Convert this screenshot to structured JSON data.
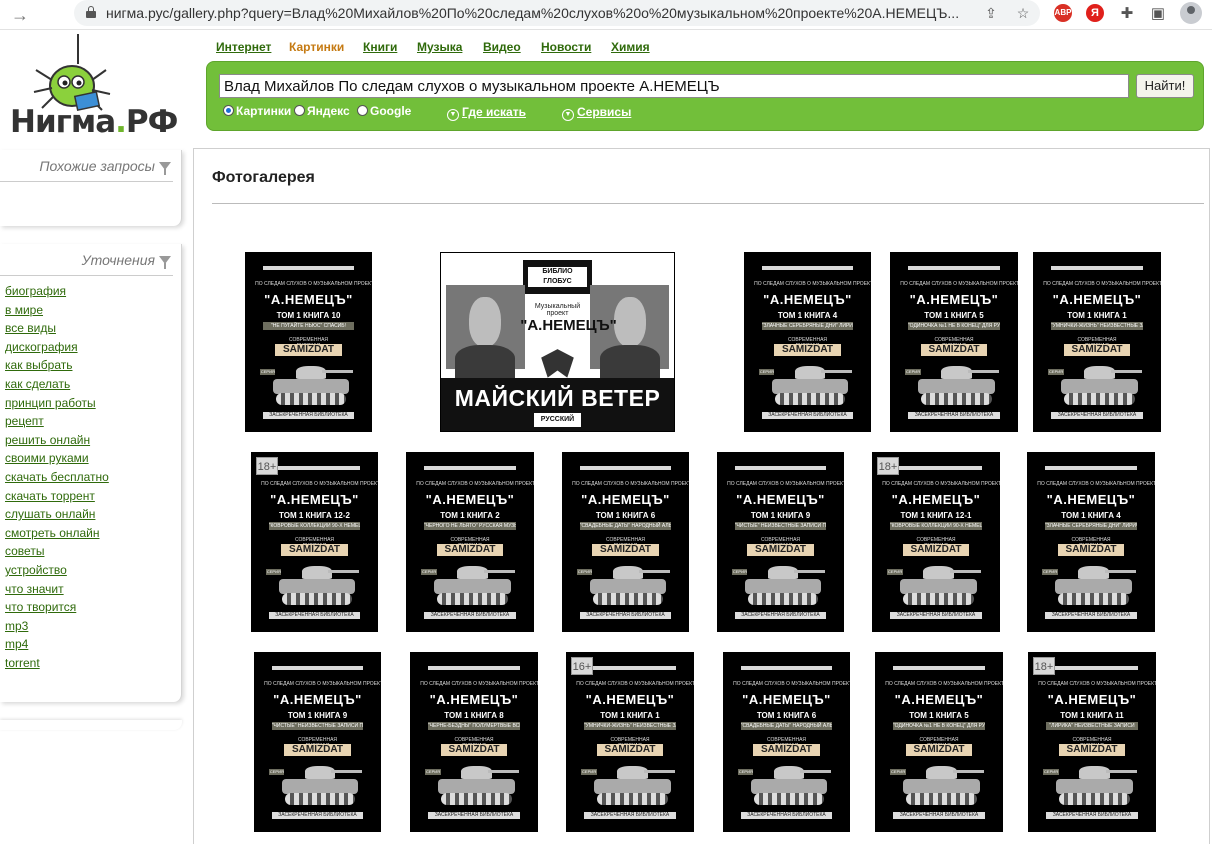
{
  "browser": {
    "url": "нигма.рус/gallery.php?query=Влад%20Михайлов%20По%20следам%20слухов%20о%20музыкальном%20проекте%20А.НЕМЕЦЪ...",
    "ext_abp": "ABP",
    "ext_yandex": "Я"
  },
  "logo": {
    "text_main": "Нигма",
    "text_dot": ".",
    "text_tld": "РФ"
  },
  "nav": {
    "items": [
      "Интернет",
      "Картинки",
      "Книги",
      "Музыка",
      "Видео",
      "Новости",
      "Химия"
    ],
    "active": "Картинки"
  },
  "search": {
    "query": "Влад Михайлов По следам слухов о музыкальном проекте А.НЕМЕЦЪ",
    "button": "Найти!",
    "engines": [
      "Картинки",
      "Яндекс",
      "Google"
    ],
    "engine_selected": "Картинки",
    "where": "Где искать",
    "services": "Сервисы"
  },
  "sidebar": {
    "similar_title": "Похожие запросы",
    "refine_title": "Уточнения",
    "refinements": [
      "биография",
      "в мире",
      "все виды",
      "дискография",
      "как выбрать",
      "как сделать",
      "принцип работы",
      "рецепт",
      "решить онлайн",
      "своими руками",
      "скачать бесплатно",
      "скачать торрент",
      "слушать онлайн",
      "смотреть онлайн",
      "советы",
      "устройство",
      "что значит",
      "что творится",
      "mp3",
      "mp4",
      "torrent"
    ]
  },
  "gallery": {
    "title": "Фотогалерея",
    "cover": {
      "sub": "ПО СЛЕДАМ СЛУХОВ О МУЗЫКАЛЬНОМ ПРОЕКТЕ",
      "title": "\"А.НЕМЕЦЪ\"",
      "brand_top": "СОВРЕМЕННАЯ РУССКАЯ",
      "brand": "SAMIZDAT",
      "seria": "СЕРИЯ",
      "foot": "ЗАСЕКРЕЧЕННАЯ БИБЛИОТЕКА"
    },
    "wide": {
      "publisher": "БИБЛИО ГЛОБУС",
      "project": "Музыкальный проект",
      "name": "\"А.НЕМЕЦЪ\"",
      "title": "МАЙСКИЙ ВЕТЕР",
      "tag": "РУССКИЙ ХИТ"
    },
    "books": [
      {
        "vol": "ТОМ 1 КНИГА 10",
        "band": "\"НЕ ПУГАЙТЕ НЬЮС\" СПАСИБ!",
        "age": ""
      },
      {
        "vol": "ТОМ 1 КНИГА 4",
        "band": "\"ЗЛАЧНЫЕ СЕРЕБРЯНЫЕ ДНИ\" ЛИРИЧЕСКИЙ АЛЬБОМ",
        "age": ""
      },
      {
        "vol": "ТОМ 1 КНИГА 5",
        "band": "\"ОДИНОЧКА №1 НЕ В КОНЕЦ\" ДЛЯ РУССКОГО ДЫРЯВОГО",
        "age": ""
      },
      {
        "vol": "ТОМ 1 КНИГА 1",
        "band": "\"УМНИЧКИ-ЖИЗНЬ\" НЕИЗВЕСТНЫЕ ЗАПИСИ",
        "age": ""
      },
      {
        "vol": "ТОМ 1 КНИГА 12-2",
        "band": "\"КОВРОВЫЕ КОЛЛЕКЦИИ 90-Х НЕМЕЦ\" 1944",
        "age": "18+"
      },
      {
        "vol": "ТОМ 1 КНИГА 2",
        "band": "\"ЧЕРНОГО НЕ ЛЬЯТО\" РУССКАЯ МУЗЫКАЛЬНАЯ КЛАССИКА",
        "age": ""
      },
      {
        "vol": "ТОМ 1 КНИГА 6",
        "band": "\"СВАДЕБНЫЕ ДАТЫ\" НАРОДНЫЙ АЛЬБОМ",
        "age": ""
      },
      {
        "vol": "ТОМ 1 КНИГА 9",
        "band": "\"ЧИСТЫЕ\" НЕИЗВЕСТНЫЕ ЗАПИСИ ПОЛУМЕРТВЫХ",
        "age": ""
      },
      {
        "vol": "ТОМ 1 КНИГА 12-1",
        "band": "\"КОВРОВЫЕ КОЛЛЕКЦИИ 90-Х НЕМЕЦ\" 1944",
        "age": "18+"
      },
      {
        "vol": "ТОМ 1 КНИГА 4",
        "band": "\"ЗЛАЧНЫЕ СЕРЕБРЯНЫЕ ДНИ\" ЛИРИЧЕСКИЙ АЛЬБОМ",
        "age": ""
      },
      {
        "vol": "ТОМ 1 КНИГА 9",
        "band": "\"ЧИСТЫЕ\" НЕИЗВЕСТНЫЕ ЗАПИСИ ПОЛУМЕРТВЫХ",
        "age": ""
      },
      {
        "vol": "ТОМ 1 КНИГА 8",
        "band": "\"ЧЕРНЕ-БЕЗДНЫ\" ПОЛУМЕРТВЫЕ ВСЕГДА",
        "age": ""
      },
      {
        "vol": "ТОМ 1 КНИГА 1",
        "band": "\"УМНИЧКИ-ЖИЗНЬ\" НЕИЗВЕСТНЫЕ ЗАПИСИ",
        "age": "16+"
      },
      {
        "vol": "ТОМ 1 КНИГА 6",
        "band": "\"СВАДЕБНЫЕ ДАТЫ\" НАРОДНЫЙ АЛЬБОМ",
        "age": ""
      },
      {
        "vol": "ТОМ 1 КНИГА 5",
        "band": "\"ОДИНОЧКА №1 НЕ В КОНЕЦ\" ДЛЯ РУССКОГО ДЫРЯВОГО",
        "age": ""
      },
      {
        "vol": "ТОМ 1 КНИГА 11",
        "band": "\"ЛИРИКА\" НЕИЗВЕСТНЫЕ ЗАПИСИ",
        "age": "18+"
      }
    ]
  }
}
